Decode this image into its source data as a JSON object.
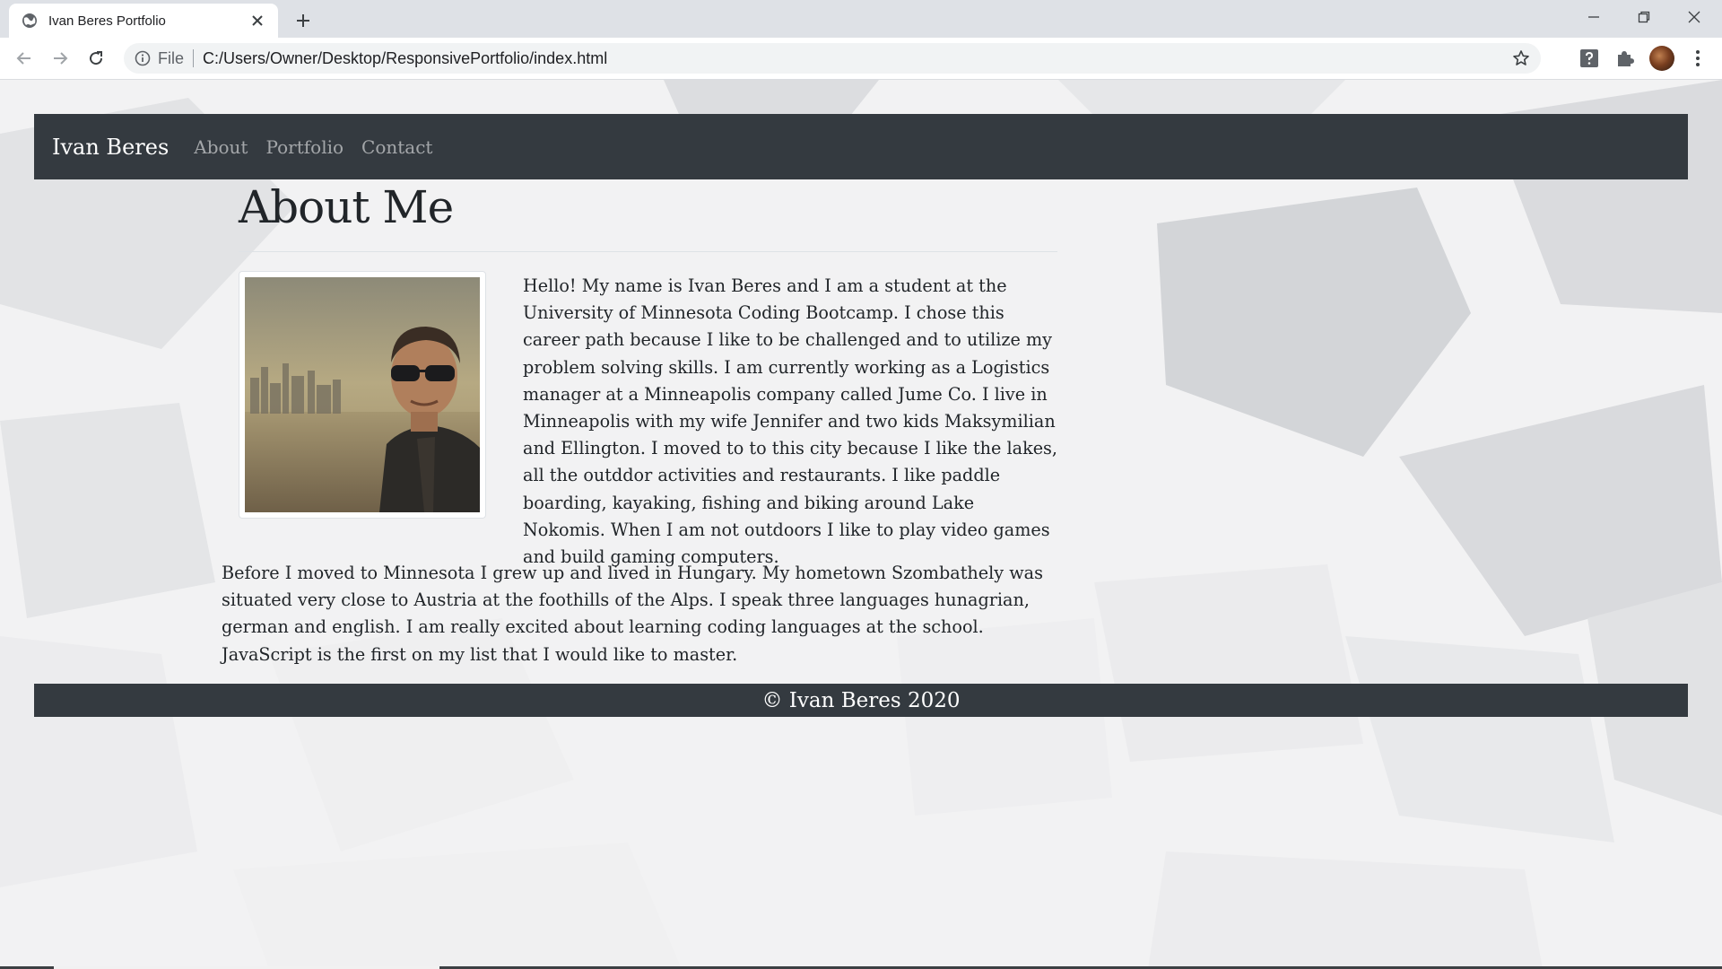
{
  "browser": {
    "tab_title": "Ivan Beres Portfolio",
    "url_scheme": "File",
    "url": "C:/Users/Owner/Desktop/ResponsivePortfolio/index.html",
    "icons": [
      "globe-icon",
      "close-icon",
      "plus-icon",
      "minimize-icon",
      "restore-icon",
      "close-window-icon",
      "back-icon",
      "forward-icon",
      "reload-icon",
      "info-icon",
      "star-icon",
      "help-extension-icon",
      "puzzle-icon",
      "profile-avatar",
      "kebab-menu-icon"
    ]
  },
  "site": {
    "brand": "Ivan Beres",
    "nav": [
      "About",
      "Portfolio",
      "Contact"
    ],
    "heading": "About Me",
    "bio_paragraph_1": "Hello! My name is Ivan Beres and I am a student at the University of Minnesota Coding Bootcamp. I chose this career path because I like to be challenged and to utilize my problem solving skills. I am currently working as a Logistics manager at a Minneapolis company called Jume Co. I live in Minneapolis with my wife Jennifer and two kids Maksymilian and Ellington. I moved to to this city because I like the lakes, all the outddor activities and restaurants. I like paddle boarding, kayaking, fishing and biking around Lake Nokomis. When I am not outdoors I like to play video games and build gaming computers.",
    "bio_paragraph_2": "Before I moved to Minnesota I grew up and lived in Hungary. My hometown Szombathely was situated very close to Austria at the foothills of the Alps. I speak three languages hunagrian, german and english. I am really excited about learning coding languages at the school. JavaScript is the first on my list that I would like to master.",
    "footer": "© Ivan Beres 2020"
  },
  "colors": {
    "navbar_bg": "#343a40",
    "page_bg": "#f3f3f4",
    "text": "#212529",
    "nav_link": "rgba(255,255,255,0.55)"
  }
}
